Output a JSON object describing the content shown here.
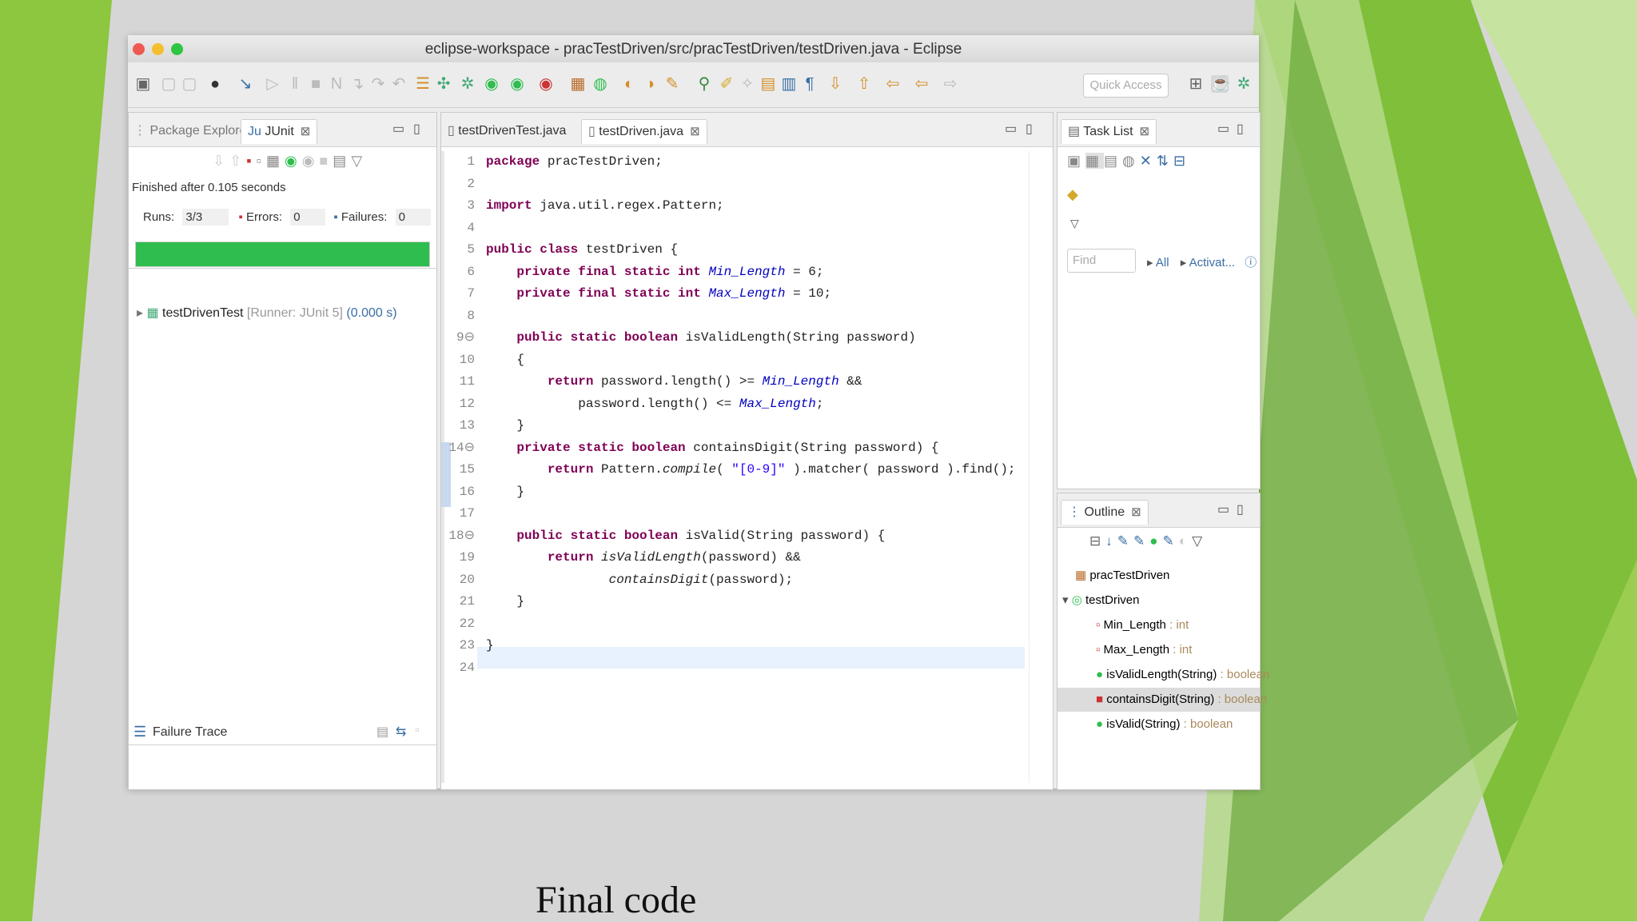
{
  "window": {
    "title": "eclipse-workspace - pracTestDriven/src/pracTestDriven/testDriven.java - Eclipse"
  },
  "toolbar": {
    "quick_access": "Quick Access"
  },
  "left_panel": {
    "tabs": [
      "Package Explorer",
      "JUnit"
    ],
    "status": "Finished after 0.105 seconds",
    "runs_label": "Runs:",
    "runs_value": "3/3",
    "errors_label": "Errors:",
    "errors_value": "0",
    "failures_label": "Failures:",
    "failures_value": "0",
    "progress": 1.0,
    "progress_color": "#2ebd4e",
    "test_name": "testDrivenTest",
    "test_runner": "[Runner: JUnit 5]",
    "test_time": "(0.000 s)",
    "failure_trace": "Failure Trace"
  },
  "editor": {
    "tabs": [
      "testDrivenTest.java",
      "testDriven.java"
    ],
    "active_tab": "testDriven.java",
    "lines": [
      "package pracTestDriven;",
      "",
      "import java.util.regex.Pattern;",
      "",
      "public class testDriven {",
      "    private final static int Min_Length = 6;",
      "    private final static int Max_Length = 10;",
      "",
      "    public static boolean isValidLength(String password)",
      "    {",
      "        return password.length() >= Min_Length &&",
      "            password.length() <= Max_Length;",
      "    }",
      "    private static boolean containsDigit(String password) {",
      "        return Pattern.compile( \"[0-9]\" ).matcher( password ).find();",
      "    }",
      "",
      "    public static boolean isValid(String password) {",
      "        return isValidLength(password) &&",
      "                containsDigit(password);",
      "    }",
      "",
      "}",
      ""
    ]
  },
  "task_list": {
    "tab": "Task List",
    "find_placeholder": "Find",
    "all_label": "All",
    "activate_label": "Activat..."
  },
  "outline": {
    "tab": "Outline",
    "items": [
      {
        "label": "pracTestDriven",
        "type": ""
      },
      {
        "label": "testDriven",
        "type": ""
      },
      {
        "label": "Min_Length",
        "type": ": int"
      },
      {
        "label": "Max_Length",
        "type": ": int"
      },
      {
        "label": "isValidLength(String)",
        "type": ": boolean"
      },
      {
        "label": "containsDigit(String)",
        "type": ": boolean"
      },
      {
        "label": "isValid(String)",
        "type": ": boolean"
      }
    ]
  },
  "caption": "Final code"
}
